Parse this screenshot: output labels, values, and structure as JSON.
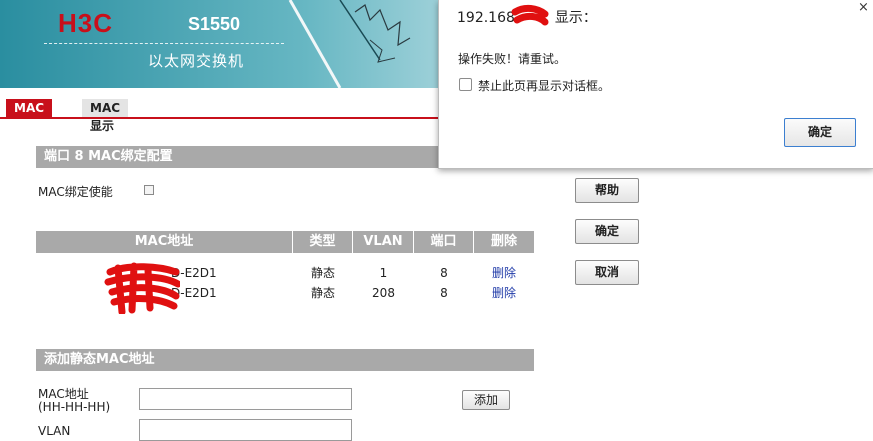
{
  "banner": {
    "logo": "H3C",
    "model": "S1550",
    "subtitle": "以太网交换机"
  },
  "tabs": [
    {
      "label": "MAC绑定",
      "active": true
    },
    {
      "label": "MAC显示",
      "active": false
    }
  ],
  "config": {
    "title": "端口  8  MAC绑定配置",
    "enable_label": "MAC绑定使能",
    "enable_checked": false
  },
  "table": {
    "headers": [
      "MAC地址",
      "类型",
      "VLAN",
      "端口",
      "删除"
    ],
    "rows": [
      {
        "mac": "D-E2D1",
        "type": "静态",
        "vlan": "1",
        "port": "8",
        "delete": "删除"
      },
      {
        "mac": "D-E2D1",
        "type": "静态",
        "vlan": "208",
        "port": "8",
        "delete": "删除"
      }
    ]
  },
  "buttons": {
    "help": "帮助",
    "ok": "确定",
    "cancel": "取消",
    "add": "添加"
  },
  "add_static": {
    "title": "添加静态MAC地址",
    "mac_label": "MAC地址",
    "mac_format": "(HH-HH-HH)",
    "vlan_label": "VLAN",
    "mac_value": "",
    "vlan_value": ""
  },
  "dialog": {
    "title_prefix": "192.168",
    "title_suffix": "显示：",
    "message": "操作失败！请重试。",
    "suppress_label": "禁止此页再显示对话框。",
    "suppress_checked": false,
    "ok_label": "确定",
    "close_glyph": "×"
  },
  "colors": {
    "accent_red": "#c8101b",
    "header_gray": "#a9a9a9",
    "link_blue": "#1f3aa8",
    "banner_teal": "#2a8ea0"
  }
}
